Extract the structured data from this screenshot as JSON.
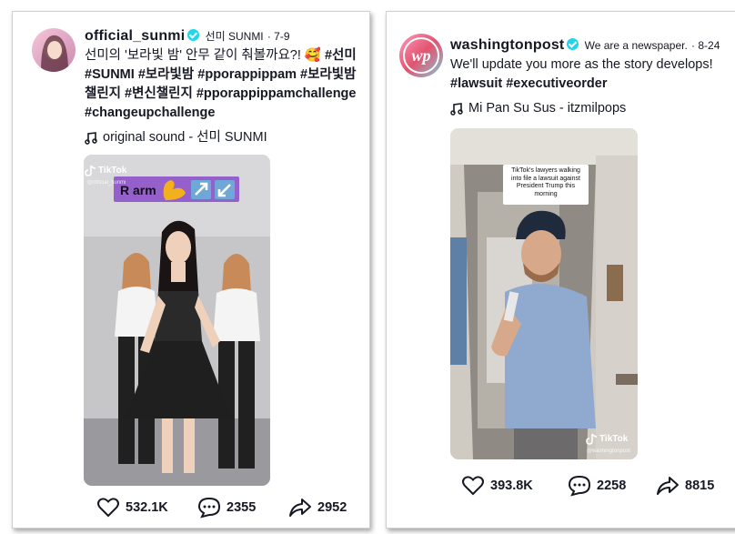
{
  "posts": [
    {
      "username": "official_sunmi",
      "display_name": "선미 SUNMI",
      "date": "7-9",
      "caption_prefix": "선미의 '보라빛 밤' 안무 같이 춰볼까요?! 🥰 ",
      "hashtags": "#선미 #SUNMI #보라빛밤 #pporappippam #보라빛밤챌린지 #변신챌린지 #pporappippamchallenge #changeupchallenge",
      "music": "original sound - 선미 SUNMI",
      "video": {
        "watermark": "TikTok",
        "watermark_user": "@official_sunmi",
        "overlay_text": "R arm",
        "overlay_icons": [
          "flexed-arm-icon",
          "arrow-up-right-icon",
          "arrow-down-left-icon"
        ]
      },
      "likes": "532.1K",
      "comments": "2355",
      "shares": "2952"
    },
    {
      "username": "washingtonpost",
      "display_name": "We are a newspaper.",
      "date": "8-24",
      "caption_prefix": "We'll update you more as the story develops! ",
      "hashtags": "#lawsuit #executiveorder",
      "music": "Mi Pan Su Sus - itzmilpops",
      "video": {
        "caption_box": "TikTok's lawyers walking into file a lawsuit against President Trump this morning",
        "watermark": "TikTok",
        "watermark_user": "@washingtonpost"
      },
      "likes": "393.8K",
      "comments": "2258",
      "shares": "8815"
    }
  ]
}
